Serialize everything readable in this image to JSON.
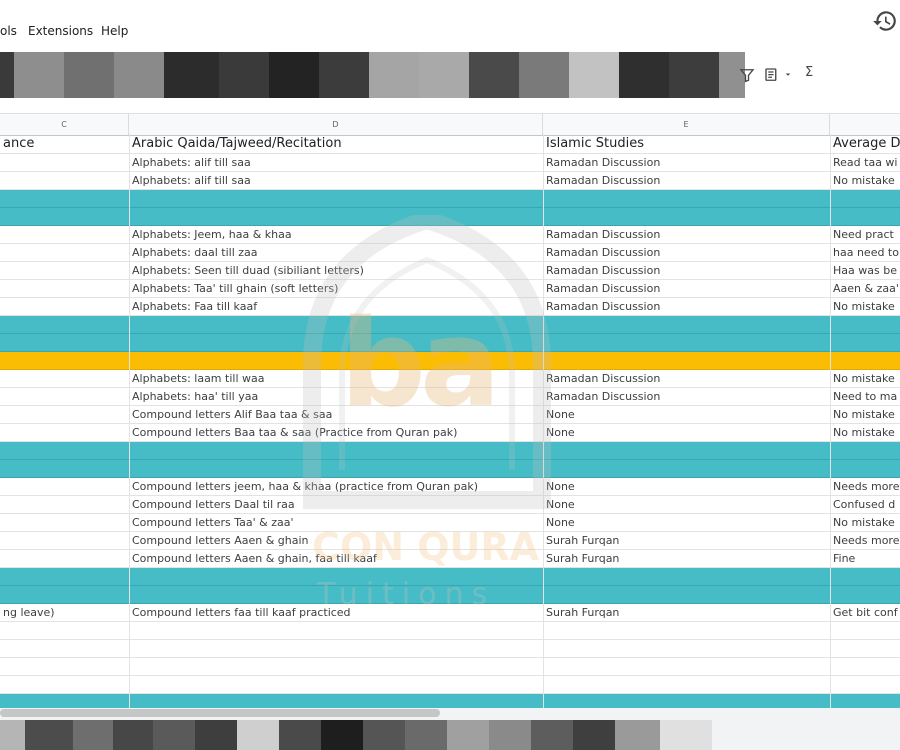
{
  "menubar": {
    "items": [
      "ols",
      "Extensions",
      "Help"
    ]
  },
  "toolbar": {
    "sigma_glyph": "Σ"
  },
  "column_headers": [
    "C",
    "D",
    "E"
  ],
  "table": {
    "header": [
      "ance",
      "Arabic Qaida/Tajweed/Recitation",
      "Islamic Studies",
      "Average D"
    ],
    "rows": [
      {
        "type": "data",
        "cells": [
          "",
          "Alphabets: alif till saa",
          "Ramadan Discussion",
          "Read taa wi"
        ]
      },
      {
        "type": "data",
        "cells": [
          "",
          "Alphabets: alif till saa",
          "Ramadan Discussion",
          "No mistake"
        ]
      },
      {
        "type": "teal",
        "cells": [
          "",
          "",
          "",
          ""
        ]
      },
      {
        "type": "teal",
        "cells": [
          "",
          "",
          "",
          ""
        ]
      },
      {
        "type": "data",
        "cells": [
          "",
          "Alphabets: Jeem, haa & khaa",
          "Ramadan Discussion",
          "Need pract"
        ]
      },
      {
        "type": "data",
        "cells": [
          "",
          "Alphabets: daal till zaa",
          "Ramadan Discussion",
          "haa need to"
        ]
      },
      {
        "type": "data",
        "cells": [
          "",
          "Alphabets: Seen till duad (sibiliant letters)",
          "Ramadan Discussion",
          "Haa was be"
        ]
      },
      {
        "type": "data",
        "cells": [
          "",
          "Alphabets: Taa' till ghain (soft letters)",
          "Ramadan Discussion",
          "Aaen & zaa'"
        ]
      },
      {
        "type": "data",
        "cells": [
          "",
          "Alphabets: Faa till kaaf",
          "Ramadan Discussion",
          "No mistake"
        ]
      },
      {
        "type": "teal",
        "cells": [
          "",
          "",
          "",
          ""
        ]
      },
      {
        "type": "teal",
        "cells": [
          "",
          "",
          "",
          ""
        ]
      },
      {
        "type": "yellow",
        "cells": [
          "",
          "",
          "",
          ""
        ]
      },
      {
        "type": "data",
        "cells": [
          "",
          "Alphabets: laam till waa",
          "Ramadan Discussion",
          "No mistake"
        ]
      },
      {
        "type": "data",
        "cells": [
          "",
          "Alphabets: haa' till yaa",
          "Ramadan Discussion",
          "Need to ma"
        ]
      },
      {
        "type": "data",
        "cells": [
          "",
          "Compound letters Alif Baa taa & saa",
          "None",
          "No mistake"
        ]
      },
      {
        "type": "data",
        "cells": [
          "",
          "Compound letters Baa taa & saa (Practice from Quran pak)",
          "None",
          "No mistake"
        ]
      },
      {
        "type": "teal",
        "cells": [
          "",
          "",
          "",
          ""
        ]
      },
      {
        "type": "teal",
        "cells": [
          "",
          "",
          "",
          ""
        ]
      },
      {
        "type": "data",
        "cells": [
          "",
          "Compound letters jeem, haa & khaa (practice from Quran pak)",
          "None",
          "Needs more"
        ]
      },
      {
        "type": "data",
        "cells": [
          "",
          "Compound letters Daal til raa",
          "None",
          "Confused d"
        ]
      },
      {
        "type": "data",
        "cells": [
          "",
          "Compound letters Taa' & zaa'",
          "None",
          "No mistake"
        ]
      },
      {
        "type": "data",
        "cells": [
          "",
          "Compound letters Aaen & ghain",
          "Surah Furqan",
          "Needs more"
        ]
      },
      {
        "type": "data",
        "cells": [
          "",
          "Compound letters Aaen & ghain, faa till kaaf",
          "Surah Furqan",
          "Fine"
        ]
      },
      {
        "type": "teal",
        "cells": [
          "",
          "",
          "",
          ""
        ]
      },
      {
        "type": "teal",
        "cells": [
          "",
          "",
          "",
          ""
        ]
      },
      {
        "type": "data",
        "cells": [
          "ng leave)",
          "Compound letters faa till kaaf practiced",
          "Surah Furqan",
          "Get bit conf"
        ]
      },
      {
        "type": "data",
        "cells": [
          "",
          "",
          "",
          ""
        ]
      },
      {
        "type": "data",
        "cells": [
          "",
          "",
          "",
          ""
        ]
      },
      {
        "type": "data",
        "cells": [
          "",
          "",
          "",
          ""
        ]
      },
      {
        "type": "data",
        "cells": [
          "",
          "",
          "",
          ""
        ]
      },
      {
        "type": "teal",
        "cells": [
          "",
          "",
          "",
          ""
        ]
      }
    ]
  },
  "watermark": {
    "logo_letters": "ba",
    "line1": "CON QURA",
    "line2": "Tuitions"
  },
  "colors": {
    "teal_row": "#46bdc6",
    "yellow_row": "#fbbc04",
    "watermark": "#bdbdbd"
  }
}
